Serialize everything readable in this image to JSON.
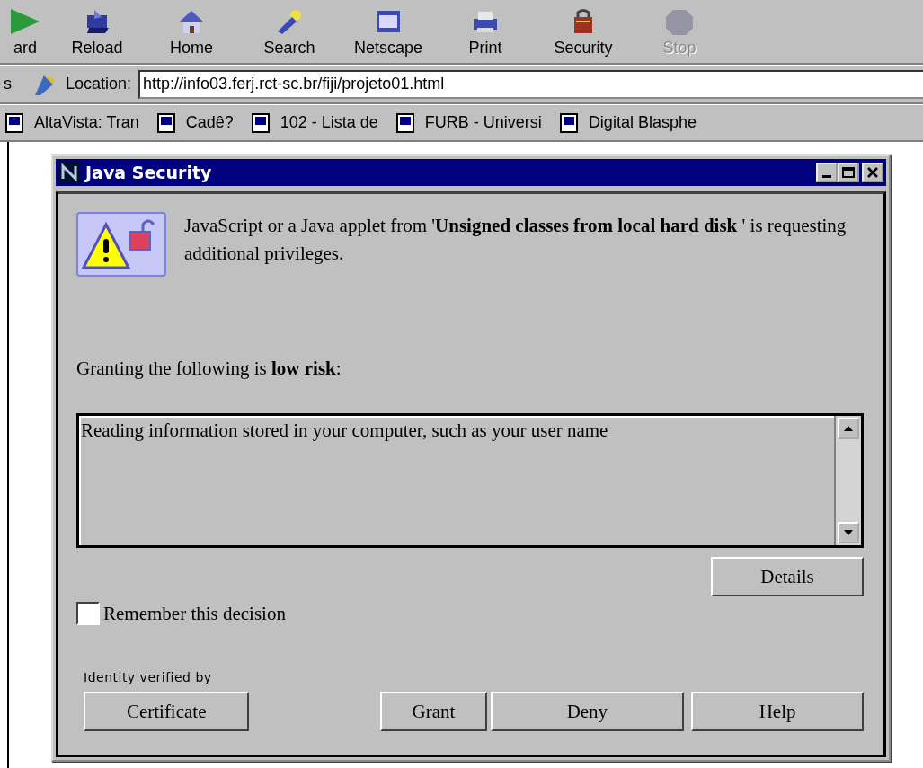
{
  "toolbar": {
    "buttons": [
      {
        "label": "ard",
        "disabled": false
      },
      {
        "label": "Reload",
        "disabled": false
      },
      {
        "label": "Home",
        "disabled": false
      },
      {
        "label": "Search",
        "disabled": false
      },
      {
        "label": "Netscape",
        "disabled": false
      },
      {
        "label": "Print",
        "disabled": false
      },
      {
        "label": "Security",
        "disabled": false
      },
      {
        "label": "Stop",
        "disabled": true
      }
    ]
  },
  "location_bar": {
    "cut_label": "s",
    "label": "Location:",
    "value": "http://info03.ferj.rct-sc.br/fiji/projeto01.html"
  },
  "personal_toolbar": {
    "items": [
      "AltaVista: Tran",
      "Cadê?",
      "102 - Lista de",
      "FURB - Universi",
      "Digital Blasphe"
    ]
  },
  "dialog": {
    "title": "Java Security",
    "message": "JavaScript or a Java applet from '**Unsigned classes from local hard disk** ' is requesting additional privileges.",
    "risk_text": "Granting the following is **low risk**:",
    "privileges": [
      "Reading information stored in your computer, such as your user name"
    ],
    "details_button": "Details",
    "remember": {
      "label": "Remember this decision",
      "checked": false
    },
    "identity_label": "Identity verified by",
    "buttons": [
      "Certificate",
      "Grant",
      "Deny",
      "Help"
    ]
  }
}
